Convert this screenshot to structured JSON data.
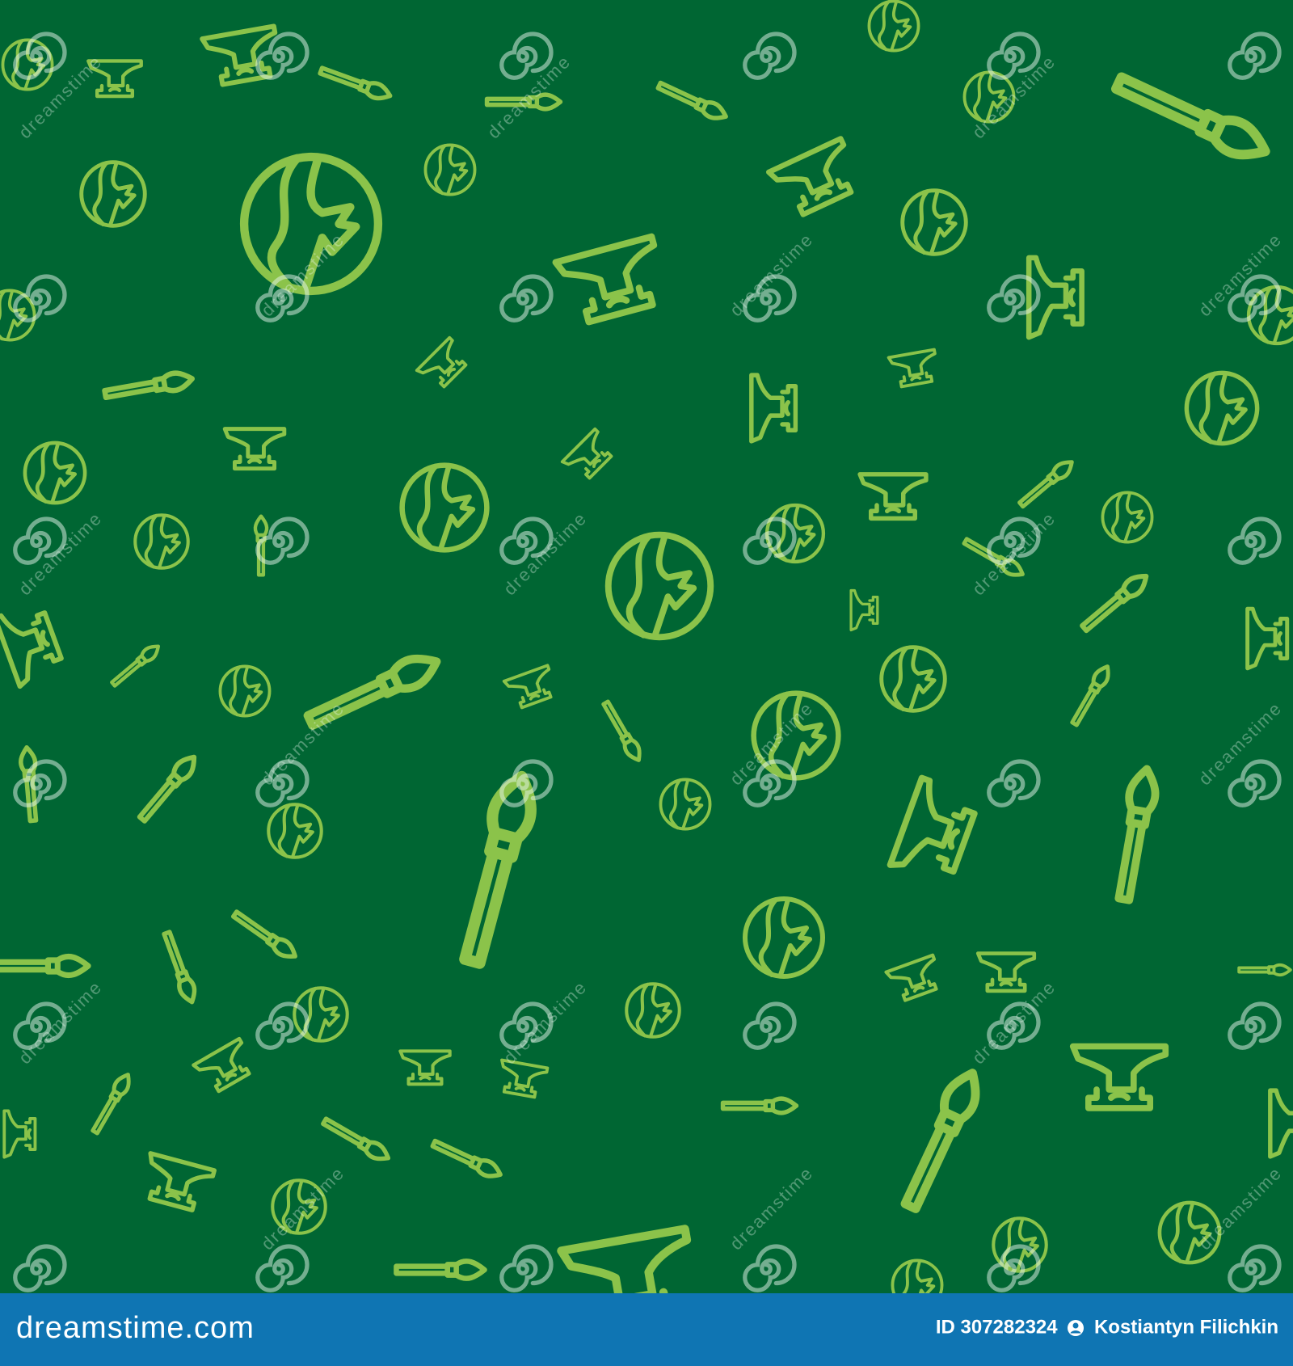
{
  "colors": {
    "background": "#006633",
    "icon_stroke": "#8bc34a",
    "watermark": "#e8f5ee",
    "footer_background": "#0f75b3",
    "footer_text": "#ffffff"
  },
  "pattern": {
    "icons": [
      "globe-icon",
      "anvil-icon",
      "paintbrush-icon"
    ],
    "watermark_text": "dreamstime",
    "watermark_symbol": "spiral-logo-icon"
  },
  "footer": {
    "logo_text": "dreamstime.com",
    "id_text": "ID 307282324",
    "author": "Kostiantyn Filichkin"
  }
}
